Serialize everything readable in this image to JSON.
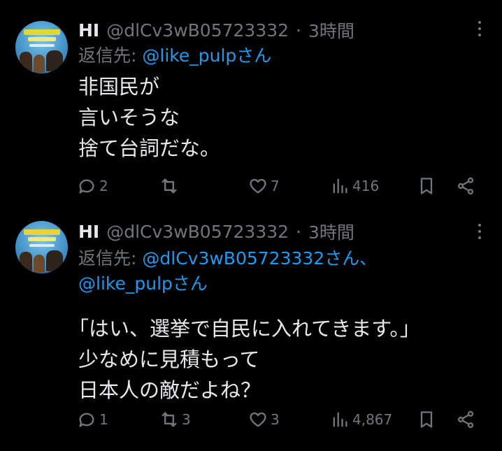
{
  "tweets": [
    {
      "name": "HI",
      "handle": "@dlCv3wB05723332",
      "dot": "·",
      "time": "3時間",
      "reply_prefix": "返信先: ",
      "reply_mentions_line1": "@like_pulpさん",
      "reply_mentions_line2": "",
      "body_lines": [
        "非国民が",
        "言いそうな",
        "捨て台詞だな。"
      ],
      "replies": "2",
      "reposts": "",
      "likes": "7",
      "views": "416"
    },
    {
      "name": "HI",
      "handle": "@dlCv3wB05723332",
      "dot": "·",
      "time": "3時間",
      "reply_prefix": "返信先: ",
      "reply_mentions_line1": "@dlCv3wB05723332さん、",
      "reply_mentions_line2": "@like_pulpさん",
      "body_lines": [
        "「はい、選挙で自民に入れてきます。」",
        "少なめに見積もって",
        "日本人の敵だよね？"
      ],
      "replies": "1",
      "reposts": "3",
      "likes": "3",
      "views": "4,867"
    }
  ],
  "icons": {
    "more": "more-icon",
    "reply": "reply-icon",
    "repost": "repost-icon",
    "like": "like-icon",
    "views": "views-icon",
    "bookmark": "bookmark-icon",
    "share": "share-icon"
  },
  "colors": {
    "background": "#000000",
    "text": "#e7e9ea",
    "muted": "#71767b",
    "link": "#1d9bf0"
  }
}
